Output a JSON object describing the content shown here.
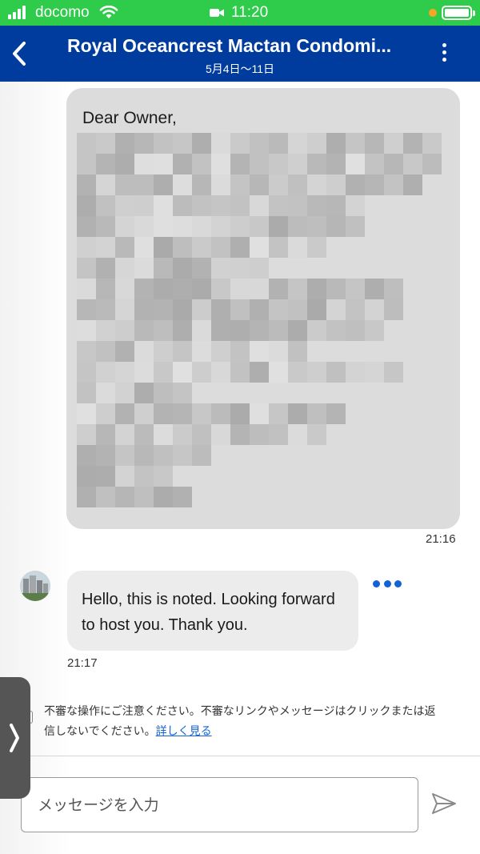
{
  "status_bar": {
    "carrier": "docomo",
    "time": "11:20",
    "colors": {
      "background": "#2ecc4a",
      "dot": "#f5a623"
    },
    "icons": [
      "signal-icon",
      "wifi-icon",
      "camera-icon",
      "battery-icon"
    ]
  },
  "header": {
    "title": "Royal Oceancrest Mactan Condomi...",
    "subtitle": "5月4日〜11日",
    "background": "#003c9e",
    "icons": [
      "back-chevron-icon",
      "more-vertical-icon"
    ]
  },
  "messages": {
    "outgoing": {
      "greeting": "Dear Owner,",
      "time": "21:16"
    },
    "incoming": {
      "text": "Hello, this is noted. Looking forward to host you. Thank you.",
      "time": "21:17"
    }
  },
  "notice": {
    "text": "不審な操作にご注意ください。不審なリンクやメッセージはクリックまたは返信しないでください。",
    "link": "詳しく見る"
  },
  "composer": {
    "placeholder": "メッセージを入力"
  },
  "accent_color": "#1463d6"
}
